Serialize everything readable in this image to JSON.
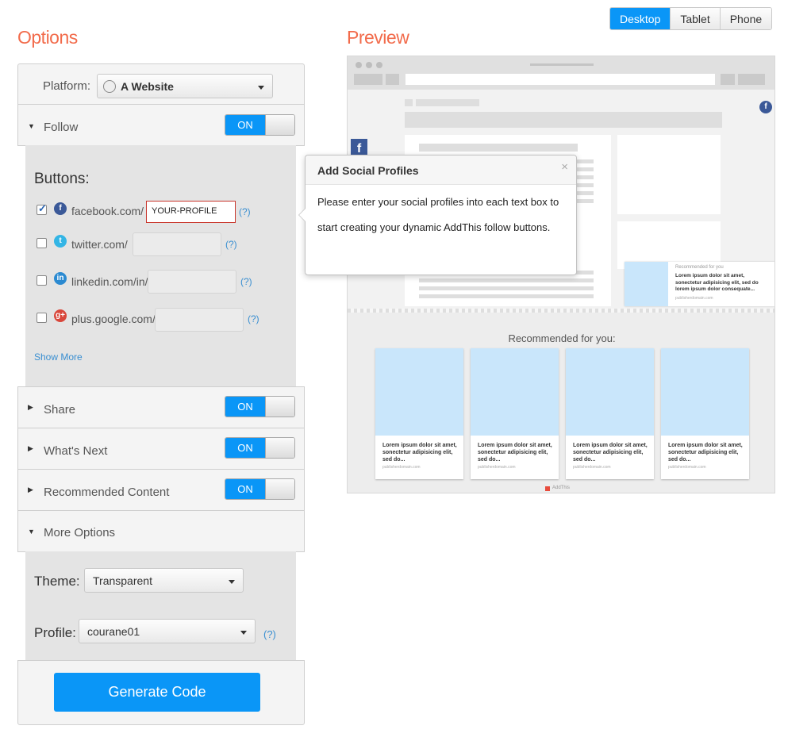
{
  "headers": {
    "options": "Options",
    "preview": "Preview"
  },
  "devices": [
    "Desktop",
    "Tablet",
    "Phone"
  ],
  "platform": {
    "label": "Platform:",
    "value": "A Website"
  },
  "sections": {
    "follow": {
      "label": "Follow",
      "toggle": "ON"
    },
    "share": {
      "label": "Share",
      "toggle": "ON"
    },
    "whats_next": {
      "label": "What's Next",
      "toggle": "ON"
    },
    "recommended": {
      "label": "Recommended Content",
      "toggle": "ON"
    },
    "more_options": {
      "label": "More Options"
    }
  },
  "buttons": {
    "heading": "Buttons:",
    "items": [
      {
        "network": "facebook.com/",
        "value": "YOUR-PROFILE",
        "checked": true,
        "help": "(?)"
      },
      {
        "network": "twitter.com/",
        "value": "",
        "checked": false,
        "help": "(?)"
      },
      {
        "network": "linkedin.com/in/",
        "value": "",
        "checked": false,
        "help": "(?)"
      },
      {
        "network": "plus.google.com/",
        "value": "",
        "checked": false,
        "help": "(?)"
      }
    ],
    "show_more": "Show More"
  },
  "theme": {
    "label": "Theme:",
    "value": "Transparent"
  },
  "profile": {
    "label": "Profile:",
    "value": "courane01",
    "help": "(?)"
  },
  "generate": "Generate Code",
  "popover": {
    "title": "Add Social Profiles",
    "close": "×",
    "body": "Please enter your social profiles into each text box to start creating your dynamic AddThis follow buttons."
  },
  "preview": {
    "rec_heading": "Recommended for you:",
    "side_rec_label": "Recommended for you",
    "side_rec_title": "Lorem ipsum dolor sit amet, sonectetur adipisicing elit, sed do lorem ipsum dolor consequate...",
    "side_rec_domain": "publisherdomain.com",
    "cards": [
      {
        "title": "Lorem ipsum dolor sit amet, sonectetur adipisicing elit, sed do...",
        "domain": "publisherdomain.com"
      },
      {
        "title": "Lorem ipsum dolor sit amet, sonectetur adipisicing elit, sed do...",
        "domain": "publisherdomain.com"
      },
      {
        "title": "Lorem ipsum dolor sit amet, sonectetur adipisicing elit, sed do...",
        "domain": "publisherdomain.com"
      },
      {
        "title": "Lorem ipsum dolor sit amet, sonectetur adipisicing elit, sed do...",
        "domain": "publisherdomain.com"
      }
    ],
    "brand": "AddThis"
  },
  "colors": {
    "accent": "#0a96f7",
    "header": "#f26b4b",
    "facebook": "#3b5998",
    "twitter": "#33b5e5",
    "linkedin": "#2b8ad1",
    "google": "#d9473b"
  }
}
